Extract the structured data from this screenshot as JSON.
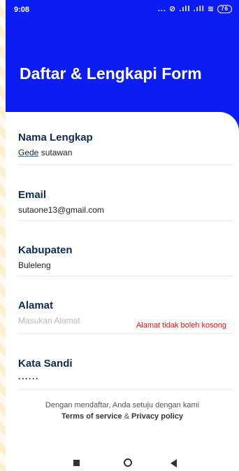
{
  "status": {
    "time": "9:08",
    "icons_text": "... ⊘ .ıll .ıll ≋",
    "battery": "76"
  },
  "page": {
    "title": "Daftar & Lengkapi Form"
  },
  "form": {
    "fields": [
      {
        "label": "Nama Lengkap",
        "value_part1": "Gede",
        "value_part2": " sutawan"
      },
      {
        "label": "Email",
        "value": "sutaone13@gmail.com"
      },
      {
        "label": "Kabupaten",
        "value": "Buleleng"
      },
      {
        "label": "Alamat",
        "placeholder": "Masukan Alamat",
        "error": "Alamat tidak boleh kosong"
      },
      {
        "label": "Kata Sandi",
        "value": "······"
      }
    ]
  },
  "terms": {
    "line1": "Dengan mendaftar, Anda setuju dengan kami",
    "tos": "Terms of service",
    "amp": " & ",
    "privacy": "Privacy policy"
  },
  "colors": {
    "header": "#0b1df2",
    "label": "#0f2b52",
    "error": "#e11111"
  }
}
